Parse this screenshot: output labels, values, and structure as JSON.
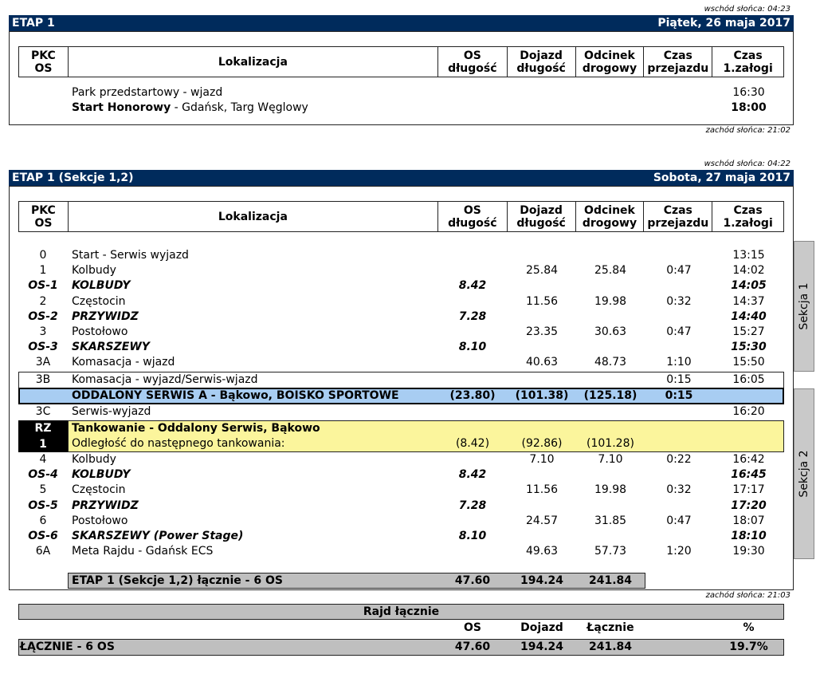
{
  "day1": {
    "sunrise": "wschód słońca: 04:23",
    "title": "ETAP 1",
    "date": "Piątek, 26 maja 2017",
    "rows": [
      {
        "code": "",
        "loc_bold": "",
        "loc": "Park przedstartowy - wjazd",
        "os": "",
        "doj": "",
        "odc": "",
        "cp": "",
        "cz": "16:30",
        "type": "normal"
      },
      {
        "code": "",
        "loc_bold": "Start Honorowy",
        "loc": " - Gdańsk, Targ Węglowy",
        "os": "",
        "doj": "",
        "odc": "",
        "cp": "",
        "cz": "18:00",
        "type": "czbold"
      }
    ],
    "sunset": "zachód słońca: 21:02"
  },
  "headers": {
    "pkc": "PKC\nOS",
    "loc": "Lokalizacja",
    "os": "OS\ndługość",
    "doj": "Dojazd\ndługość",
    "odc": "Odcinek\ndrogowy",
    "cp": "Czas\nprzejazdu",
    "cz": "Czas\n1.załogi"
  },
  "day2": {
    "sunrise": "wschód słońca: 04:22",
    "title": "ETAP 1 (Sekcje 1,2)",
    "date": "Sobota, 27 maja 2017",
    "section1": "Sekcja 1",
    "section2": "Sekcja 2",
    "rows": [
      {
        "code": "0",
        "loc": "Start - Serwis wyjazd",
        "os": "",
        "doj": "",
        "odc": "",
        "cp": "",
        "cz": "13:15",
        "type": "normal"
      },
      {
        "code": "1",
        "loc": "Kolbudy",
        "os": "",
        "doj": "25.84",
        "odc": "25.84",
        "cp": "0:47",
        "cz": "14:02",
        "type": "normal"
      },
      {
        "code": "OS-1",
        "loc": "KOLBUDY",
        "os": "8.42",
        "doj": "",
        "odc": "",
        "cp": "",
        "cz": "14:05",
        "type": "os"
      },
      {
        "code": "2",
        "loc": "Częstocin",
        "os": "",
        "doj": "11.56",
        "odc": "19.98",
        "cp": "0:32",
        "cz": "14:37",
        "type": "normal"
      },
      {
        "code": "OS-2",
        "loc": "PRZYWIDZ",
        "os": "7.28",
        "doj": "",
        "odc": "",
        "cp": "",
        "cz": "14:40",
        "type": "os"
      },
      {
        "code": "3",
        "loc": "Postołowo",
        "os": "",
        "doj": "23.35",
        "odc": "30.63",
        "cp": "0:47",
        "cz": "15:27",
        "type": "normal"
      },
      {
        "code": "OS-3",
        "loc": "SKARSZEWY",
        "os": "8.10",
        "doj": "",
        "odc": "",
        "cp": "",
        "cz": "15:30",
        "type": "os"
      },
      {
        "code": "3A",
        "loc": "Komasacja - wjazd",
        "os": "",
        "doj": "40.63",
        "odc": "48.73",
        "cp": "1:10",
        "cz": "15:50",
        "type": "normal"
      }
    ],
    "row3b": {
      "code": "3B",
      "loc": "Komasacja - wyjazd/Serwis-wjazd",
      "cp": "0:15",
      "cz": "16:05"
    },
    "remote": {
      "loc": "ODDALONY SERWIS A - Bąkowo, BOISKO SPORTOWE",
      "os": "(23.80)",
      "doj": "(101.38)",
      "odc": "(125.18)",
      "cp": "0:15"
    },
    "row3c": {
      "code": "3C",
      "loc": "Serwis-wyjazd",
      "cz": "16:20"
    },
    "refuel": {
      "code1": "RZ",
      "code2": "1",
      "title": "Tankowanie - Oddalony Serwis, Bąkowo",
      "line2": "Odległość do następnego tankowania:",
      "os": "(8.42)",
      "doj": "(92.86)",
      "odc": "(101.28)"
    },
    "rows2": [
      {
        "code": "4",
        "loc": "Kolbudy",
        "os": "",
        "doj": "7.10",
        "odc": "7.10",
        "cp": "0:22",
        "cz": "16:42",
        "type": "normal"
      },
      {
        "code": "OS-4",
        "loc": "KOLBUDY",
        "os": "8.42",
        "doj": "",
        "odc": "",
        "cp": "",
        "cz": "16:45",
        "type": "os"
      },
      {
        "code": "5",
        "loc": "Częstocin",
        "os": "",
        "doj": "11.56",
        "odc": "19.98",
        "cp": "0:32",
        "cz": "17:17",
        "type": "normal"
      },
      {
        "code": "OS-5",
        "loc": "PRZYWIDZ",
        "os": "7.28",
        "doj": "",
        "odc": "",
        "cp": "",
        "cz": "17:20",
        "type": "os"
      },
      {
        "code": "6",
        "loc": "Postołowo",
        "os": "",
        "doj": "24.57",
        "odc": "31.85",
        "cp": "0:47",
        "cz": "18:07",
        "type": "normal"
      },
      {
        "code": "OS-6",
        "loc": "SKARSZEWY (Power Stage)",
        "os": "8.10",
        "doj": "",
        "odc": "",
        "cp": "",
        "cz": "18:10",
        "type": "os"
      },
      {
        "code": "6A",
        "loc": "Meta Rajdu - Gdańsk ECS",
        "os": "",
        "doj": "49.63",
        "odc": "57.73",
        "cp": "1:20",
        "cz": "19:30",
        "type": "normal"
      }
    ],
    "total": {
      "label": "ETAP 1 (Sekcje 1,2) łącznie - 6 OS",
      "os": "47.60",
      "doj": "194.24",
      "odc": "241.84"
    },
    "sunset": "zachód słońca: 21:03"
  },
  "summary": {
    "title": "Rajd łącznie",
    "h_os": "OS",
    "h_doj": "Dojazd",
    "h_lacznie": "Łącznie",
    "h_pct": "%",
    "label": "ŁĄCZNIE - 6 OS",
    "os": "47.60",
    "doj": "194.24",
    "lacznie": "241.84",
    "pct": "19.7%"
  }
}
